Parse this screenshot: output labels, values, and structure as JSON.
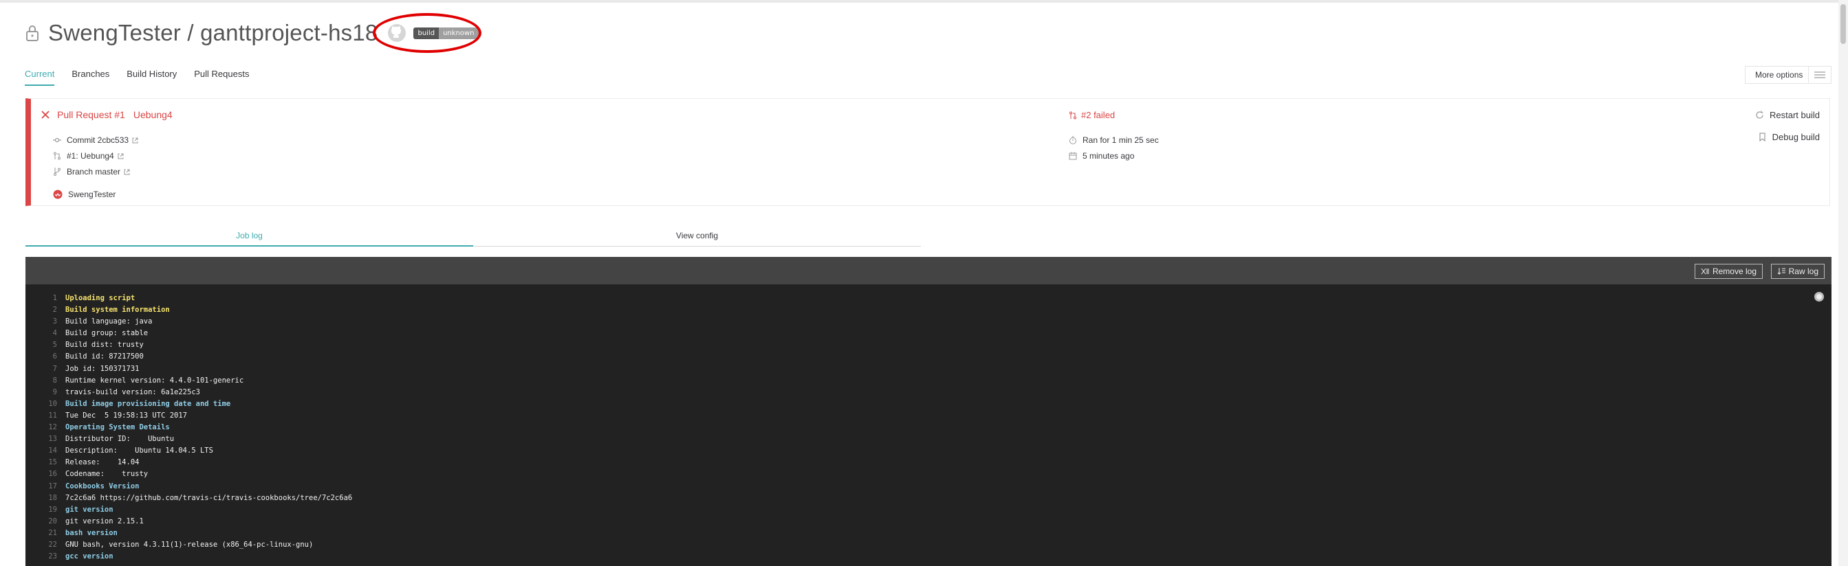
{
  "repo": {
    "owner": "SwengTester",
    "name": "ganttproject-hs18",
    "title": "SwengTester / ganttproject-hs18"
  },
  "badge": {
    "label": "build",
    "status": "unknown"
  },
  "tabs": [
    "Current",
    "Branches",
    "Build History",
    "Pull Requests"
  ],
  "more_options": "More options",
  "build": {
    "pr_label": "Pull Request #1",
    "branch_name": "Uebung4",
    "commit": "Commit 2cbc533",
    "pr_ref": "#1: Uebung4",
    "branch": "Branch master",
    "author": "SwengTester",
    "status": "#2 failed",
    "duration": "Ran for 1 min 25 sec",
    "finished": "5 minutes ago",
    "restart_label": "Restart build",
    "debug_label": "Debug build"
  },
  "log_tabs": {
    "job_log": "Job log",
    "view_config": "View config"
  },
  "log_toolbar": {
    "remove_log": "Remove log",
    "raw_log": "Raw log"
  },
  "log_lines": [
    {
      "n": "1",
      "text": "Uploading script",
      "style": "hl-yellow"
    },
    {
      "n": "2",
      "text": "Build system information",
      "style": "hl-yellow"
    },
    {
      "n": "3",
      "text": "Build language: java",
      "style": ""
    },
    {
      "n": "4",
      "text": "Build group: stable",
      "style": ""
    },
    {
      "n": "5",
      "text": "Build dist: trusty",
      "style": ""
    },
    {
      "n": "6",
      "text": "Build id: 87217500",
      "style": ""
    },
    {
      "n": "7",
      "text": "Job id: 150371731",
      "style": ""
    },
    {
      "n": "8",
      "text": "Runtime kernel version: 4.4.0-101-generic",
      "style": ""
    },
    {
      "n": "9",
      "text": "travis-build version: 6a1e225c3",
      "style": ""
    },
    {
      "n": "10",
      "text": "Build image provisioning date and time",
      "style": "hl-blue"
    },
    {
      "n": "11",
      "text": "Tue Dec  5 19:58:13 UTC 2017",
      "style": ""
    },
    {
      "n": "12",
      "text": "Operating System Details",
      "style": "hl-blue"
    },
    {
      "n": "13",
      "text": "Distributor ID:\tUbuntu",
      "style": ""
    },
    {
      "n": "14",
      "text": "Description:\tUbuntu 14.04.5 LTS",
      "style": ""
    },
    {
      "n": "15",
      "text": "Release:\t14.04",
      "style": ""
    },
    {
      "n": "16",
      "text": "Codename:\ttrusty",
      "style": ""
    },
    {
      "n": "17",
      "text": "Cookbooks Version",
      "style": "hl-blue"
    },
    {
      "n": "18",
      "text": "7c2c6a6 https://github.com/travis-ci/travis-cookbooks/tree/7c2c6a6",
      "style": ""
    },
    {
      "n": "19",
      "text": "git version",
      "style": "hl-blue"
    },
    {
      "n": "20",
      "text": "git version 2.15.1",
      "style": ""
    },
    {
      "n": "21",
      "text": "bash version",
      "style": "hl-blue"
    },
    {
      "n": "22",
      "text": "GNU bash, version 4.3.11(1)-release (x86_64-pc-linux-gnu)",
      "style": ""
    },
    {
      "n": "23",
      "text": "gcc version",
      "style": "hl-blue"
    }
  ],
  "colors": {
    "failed": "#db4545",
    "accent": "#3eaaaf",
    "log_bg": "#222222"
  }
}
